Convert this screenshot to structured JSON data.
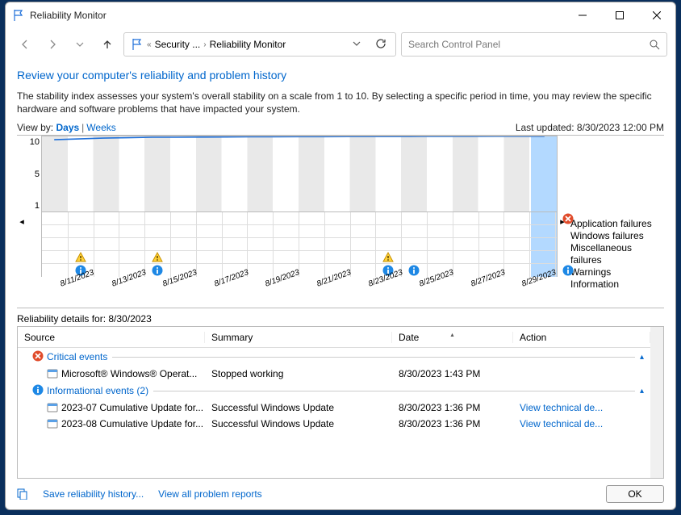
{
  "window": {
    "title": "Reliability Monitor"
  },
  "breadcrumb": {
    "ellipsis": "«",
    "parent": "Security ...",
    "current": "Reliability Monitor"
  },
  "search": {
    "placeholder": "Search Control Panel"
  },
  "page": {
    "heading": "Review your computer's reliability and problem history",
    "description": "The stability index assesses your system's overall stability on a scale from 1 to 10. By selecting a specific period in time, you may review the specific hardware and software problems that have impacted your system.",
    "view_by_label": "View by:",
    "view_days": "Days",
    "view_weeks": "Weeks",
    "last_updated_label": "Last updated:",
    "last_updated_value": "8/30/2023 12:00 PM"
  },
  "chart_data": {
    "type": "line",
    "ylim": [
      1,
      10
    ],
    "yticks": [
      "10",
      "5",
      "1"
    ],
    "x_dates": [
      "8/11/2023",
      "8/13/2023",
      "8/15/2023",
      "8/17/2023",
      "8/19/2023",
      "8/21/2023",
      "8/23/2023",
      "8/25/2023",
      "8/27/2023",
      "8/29/2023"
    ],
    "stability_index": [
      9.6,
      9.7,
      9.8,
      9.85,
      9.9,
      9.9,
      9.92,
      9.93,
      9.95,
      9.96,
      9.97,
      9.97,
      9.98,
      9.98,
      9.98,
      9.99,
      9.99,
      9.99,
      10,
      10,
      10
    ],
    "legend": [
      "Application failures",
      "Windows failures",
      "Miscellaneous failures",
      "Warnings",
      "Information"
    ],
    "selected_column": 20,
    "warn_cols": [
      1,
      4,
      13
    ],
    "info_cols": [
      1,
      4,
      13,
      14,
      20
    ],
    "appfail_cols": [
      20
    ]
  },
  "details": {
    "title": "Reliability details for: 8/30/2023",
    "columns": {
      "source": "Source",
      "summary": "Summary",
      "date": "Date",
      "action": "Action"
    },
    "groups": [
      {
        "name": "Critical events",
        "icon": "error",
        "rows": [
          {
            "source": "Microsoft® Windows® Operat...",
            "summary": "Stopped working",
            "date": "8/30/2023 1:43 PM",
            "action": ""
          }
        ]
      },
      {
        "name": "Informational events (2)",
        "icon": "info",
        "rows": [
          {
            "source": "2023-07 Cumulative Update for...",
            "summary": "Successful Windows Update",
            "date": "8/30/2023 1:36 PM",
            "action": "View technical de..."
          },
          {
            "source": "2023-08 Cumulative Update for...",
            "summary": "Successful Windows Update",
            "date": "8/30/2023 1:36 PM",
            "action": "View technical de..."
          }
        ]
      }
    ]
  },
  "footer": {
    "save_link": "Save reliability history...",
    "view_all": "View all problem reports",
    "ok": "OK"
  }
}
